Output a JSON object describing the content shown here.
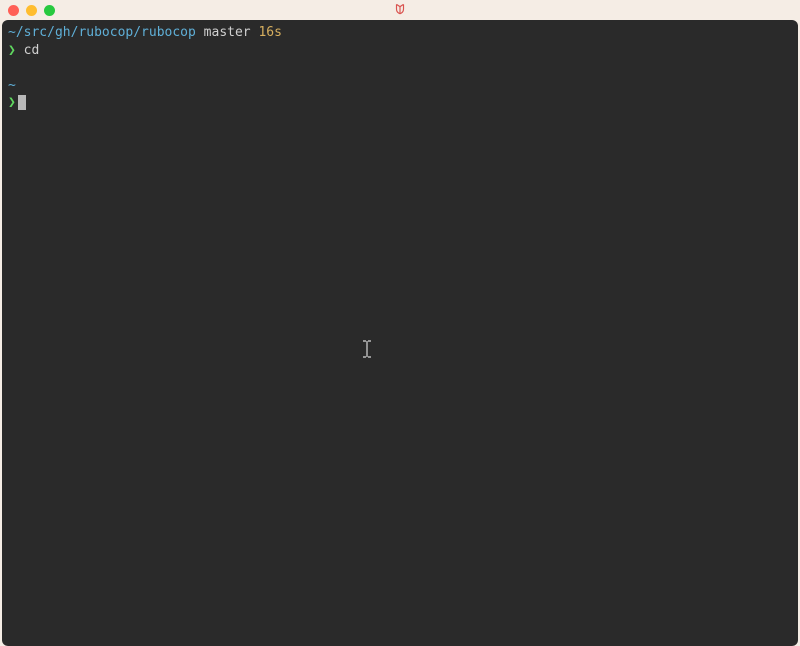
{
  "titlebar": {
    "icon_glyph": "¥"
  },
  "terminal": {
    "line1": {
      "path": "~/src/gh/rubocop/rubocop",
      "branch": "master",
      "time": "16s"
    },
    "line2": {
      "prompt": "❯",
      "command": "cd"
    },
    "line3": {
      "path": "~"
    },
    "line4": {
      "prompt": "❯"
    }
  }
}
